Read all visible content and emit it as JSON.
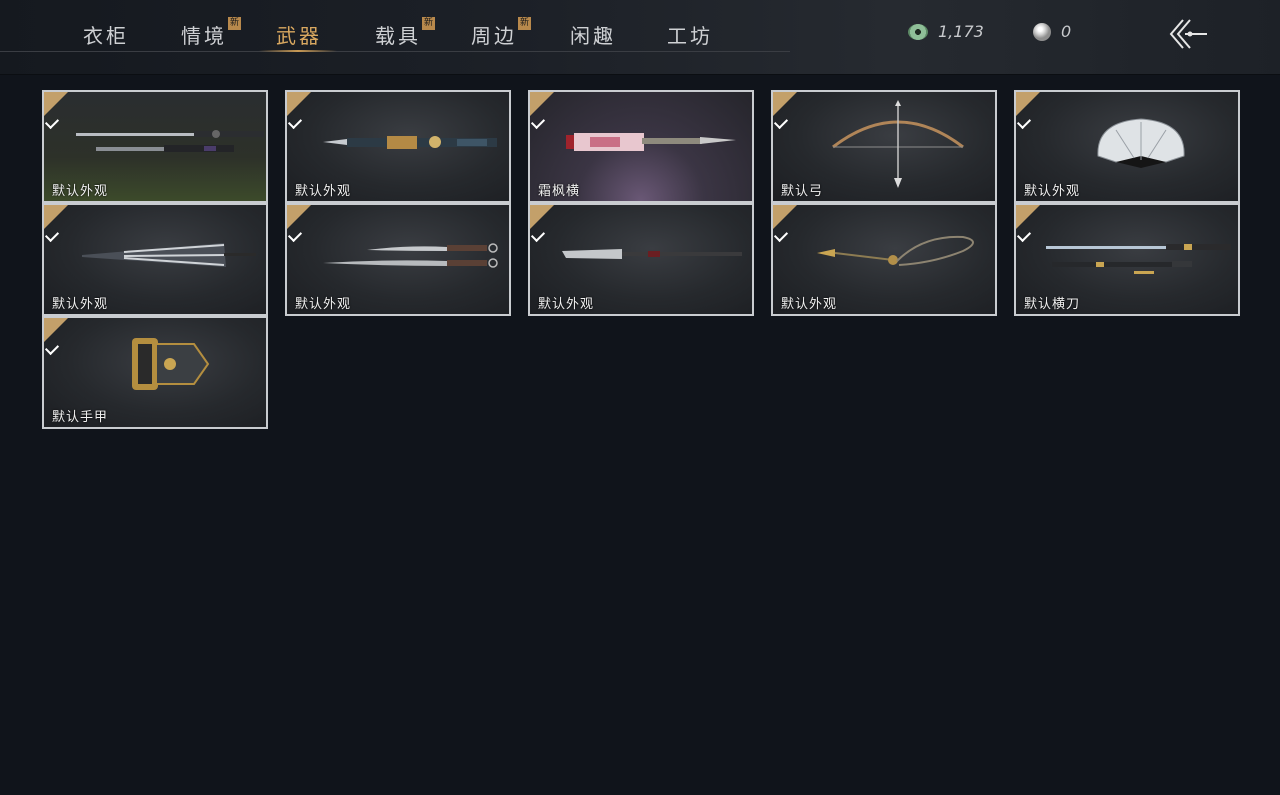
{
  "tabs": [
    {
      "label": "衣柜",
      "new": false,
      "active": false
    },
    {
      "label": "情境",
      "new": true,
      "active": false
    },
    {
      "label": "武器",
      "new": false,
      "active": true
    },
    {
      "label": "载具",
      "new": true,
      "active": false
    },
    {
      "label": "周边",
      "new": true,
      "active": false
    },
    {
      "label": "闲趣",
      "new": false,
      "active": false
    },
    {
      "label": "工坊",
      "new": false,
      "active": false
    }
  ],
  "new_badge": "新",
  "currency": {
    "jade": "1,173",
    "pearl": "0"
  },
  "items": [
    {
      "label": "默认外观",
      "icon": "straight-sword-icon",
      "equipped": true
    },
    {
      "label": "默认外观",
      "icon": "ornate-spear-icon",
      "equipped": true
    },
    {
      "label": "霜枫横",
      "icon": "pink-blade-icon",
      "equipped": true
    },
    {
      "label": "默认弓",
      "icon": "bow-icon",
      "equipped": true
    },
    {
      "label": "默认外观",
      "icon": "folding-fan-icon",
      "equipped": true
    },
    {
      "label": "默认外观",
      "icon": "umbrella-icon",
      "equipped": true
    },
    {
      "label": "默认外观",
      "icon": "twin-blades-icon",
      "equipped": true
    },
    {
      "label": "默认外观",
      "icon": "long-glaive-icon",
      "equipped": true
    },
    {
      "label": "默认外观",
      "icon": "rope-dart-icon",
      "equipped": true
    },
    {
      "label": "默认横刀",
      "icon": "hengdao-icon",
      "equipped": true
    },
    {
      "label": "默认手甲",
      "icon": "gauntlet-icon",
      "equipped": true
    }
  ],
  "colors": {
    "accent": "#d9a860",
    "check": "#c3a06a",
    "background": "#10141b"
  }
}
